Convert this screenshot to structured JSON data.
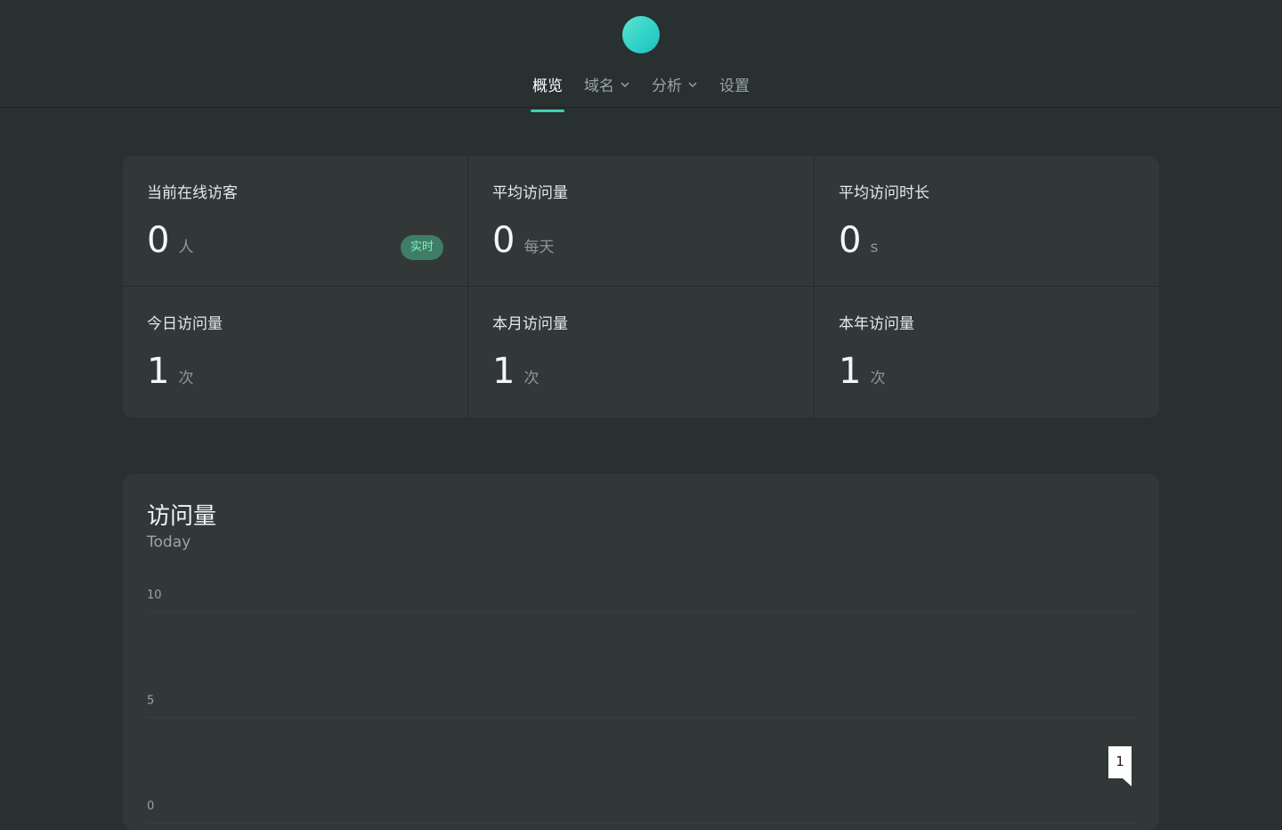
{
  "nav": {
    "items": [
      {
        "label": "概览",
        "active": true,
        "dropdown": false
      },
      {
        "label": "域名",
        "active": false,
        "dropdown": true
      },
      {
        "label": "分析",
        "active": false,
        "dropdown": true
      },
      {
        "label": "设置",
        "active": false,
        "dropdown": false
      }
    ]
  },
  "stats": [
    {
      "label": "当前在线访客",
      "value": "0",
      "unit": "人",
      "badge": "实时"
    },
    {
      "label": "平均访问量",
      "value": "0",
      "unit": "每天"
    },
    {
      "label": "平均访问时长",
      "value": "0",
      "unit": "s"
    },
    {
      "label": "今日访问量",
      "value": "1",
      "unit": "次"
    },
    {
      "label": "本月访问量",
      "value": "1",
      "unit": "次"
    },
    {
      "label": "本年访问量",
      "value": "1",
      "unit": "次"
    }
  ],
  "chart": {
    "title": "访问量",
    "subtitle": "Today"
  },
  "chart_data": {
    "type": "line",
    "title": "访问量",
    "subtitle": "Today",
    "y_ticks": [
      10,
      5,
      0
    ],
    "ylim": [
      0,
      10
    ],
    "grid": true,
    "annotations": [
      {
        "label": "1",
        "value": 1
      }
    ]
  },
  "colors": {
    "accent": "#3fd1b2",
    "background": "#283030",
    "card": "#323838",
    "badge_bg": "#3f7e66",
    "badge_text": "#7ff0c8"
  }
}
